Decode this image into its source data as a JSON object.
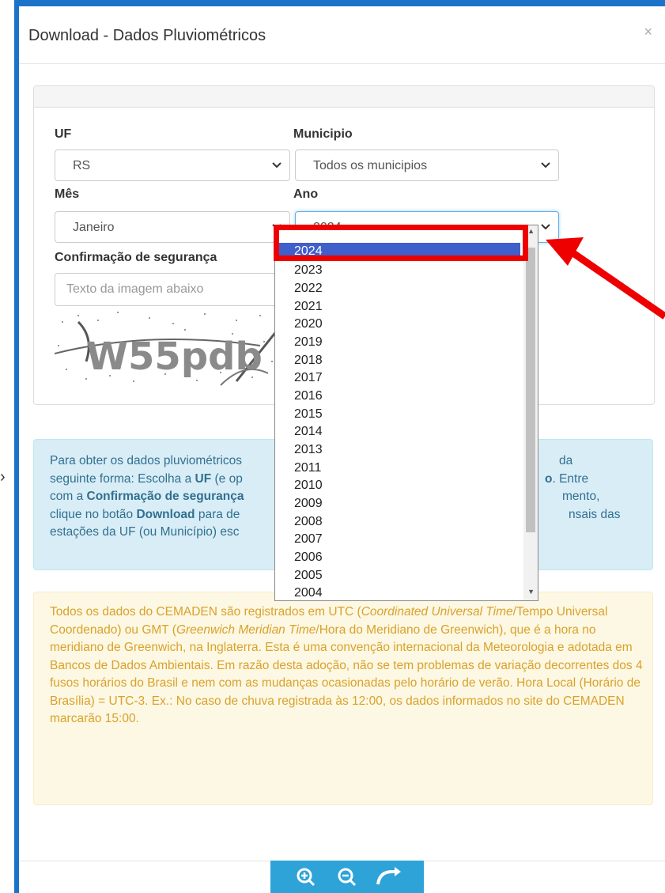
{
  "window": {
    "title": "Download - Dados Pluviométricos",
    "close_glyph": "×",
    "left_glyph": "›"
  },
  "form": {
    "uf_label": "UF",
    "uf_value": "RS",
    "municipio_label": "Municipio",
    "municipio_value": "Todos os municipios",
    "mes_label": "Mês",
    "mes_value": "Janeiro",
    "ano_label": "Ano",
    "ano_value": "2024",
    "captcha_label": "Confirmação de segurança",
    "captcha_placeholder": "Texto da imagem abaixo",
    "captcha_text": "W55pdb"
  },
  "year_options": [
    "2024",
    "2023",
    "2022",
    "2021",
    "2020",
    "2019",
    "2018",
    "2017",
    "2016",
    "2015",
    "2014",
    "2013",
    "2011",
    "2010",
    "2009",
    "2008",
    "2007",
    "2006",
    "2005",
    "2004"
  ],
  "selected_year": "2024",
  "info": {
    "line1_a": "Para obter os dados pluviométricos",
    "line1_b": "da",
    "line2_a": "seguinte forma: Escolha a ",
    "line2_uf": "UF",
    "line2_b": " (e op",
    "line2_c": "o",
    "line2_d": ". Entre",
    "line3_a": "com a ",
    "line3_conf": "Confirmação de segurança",
    "line3_b": "mento,",
    "line4_a": "clique no botão ",
    "line4_dl": "Download",
    "line4_b": " para de",
    "line4_c": "nsais das",
    "line5_a": "estações da UF (ou Município) esc"
  },
  "warning": {
    "p1": "Todos os dados do CEMADEN são registrados em UTC (",
    "p1_em": "Coordinated Universal Time",
    "p2": "/Tempo Universal Coordenado) ou GMT (",
    "p2_em": "Greenwich Meridian Time",
    "p3": "/Hora do Meridiano de Greenwich), que é a hora no meridiano de Greenwich, na Inglaterra. Esta é uma convenção internacional da Meteorologia e adotada em Bancos de Dados Ambientais. Em razão desta adoção, não se tem problemas de variação decorrentes dos 4 fusos horários do Brasil e nem com as mudanças ocasionadas pelo horário de verão. Hora Local (Horário de Brasília) = UTC-3. Ex.: No caso de chuva registrada às 12:00, os dados informados no site do CEMADEN marcarão 15:00."
  },
  "colors": {
    "accent": "#1a73c8",
    "selected_option": "#3f5fcb",
    "highlight": "#ee0000",
    "info_bg": "#d9edf7",
    "warn_bg": "#fcf8e3",
    "toolbar": "#2ea3d8"
  },
  "icons": {
    "chevron": "chevron-down-icon",
    "zoom_in": "zoom-in-icon",
    "zoom_out": "zoom-out-icon",
    "rotate": "rotate-icon"
  }
}
